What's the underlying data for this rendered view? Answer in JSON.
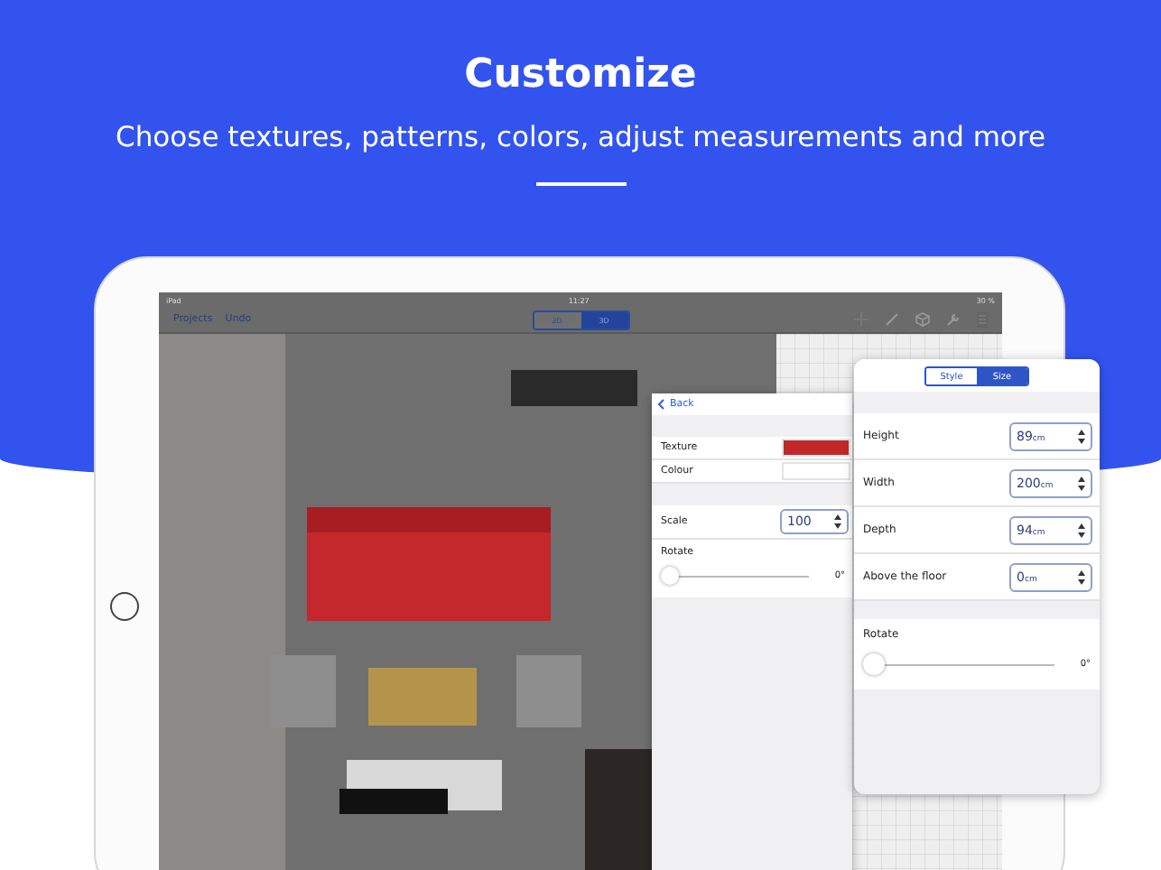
{
  "header": {
    "title": "Customize",
    "subtitle": "Choose textures, patterns, colors, adjust measurements and more"
  },
  "status_bar": {
    "device": "iPad",
    "time": "11:27",
    "battery": "30 %"
  },
  "toolbar": {
    "links": [
      "Projects",
      "Undo"
    ],
    "view_modes": [
      {
        "label": "2D",
        "selected": false
      },
      {
        "label": "3D",
        "selected": true
      }
    ]
  },
  "material_panel": {
    "back": "Back",
    "rows": [
      {
        "label": "Texture",
        "color": "#c0282c"
      },
      {
        "label": "Colour",
        "color": "#ffffff"
      }
    ],
    "scale": {
      "label": "Scale",
      "value": "100"
    },
    "rotate": {
      "label": "Rotate",
      "level": 0,
      "reading": "0°"
    }
  },
  "size_panel": {
    "tabs": [
      {
        "label": "Style",
        "selected": false
      },
      {
        "label": "Size",
        "selected": true
      }
    ],
    "fields": [
      {
        "label": "Height",
        "value": "89",
        "unit": "cm"
      },
      {
        "label": "Width",
        "value": "200",
        "unit": "cm"
      },
      {
        "label": "Depth",
        "value": "94",
        "unit": "cm"
      },
      {
        "label": "Above the floor",
        "value": "0",
        "unit": "cm"
      }
    ],
    "rotate": {
      "label": "Rotate",
      "level": 0,
      "reading": "0°"
    }
  }
}
